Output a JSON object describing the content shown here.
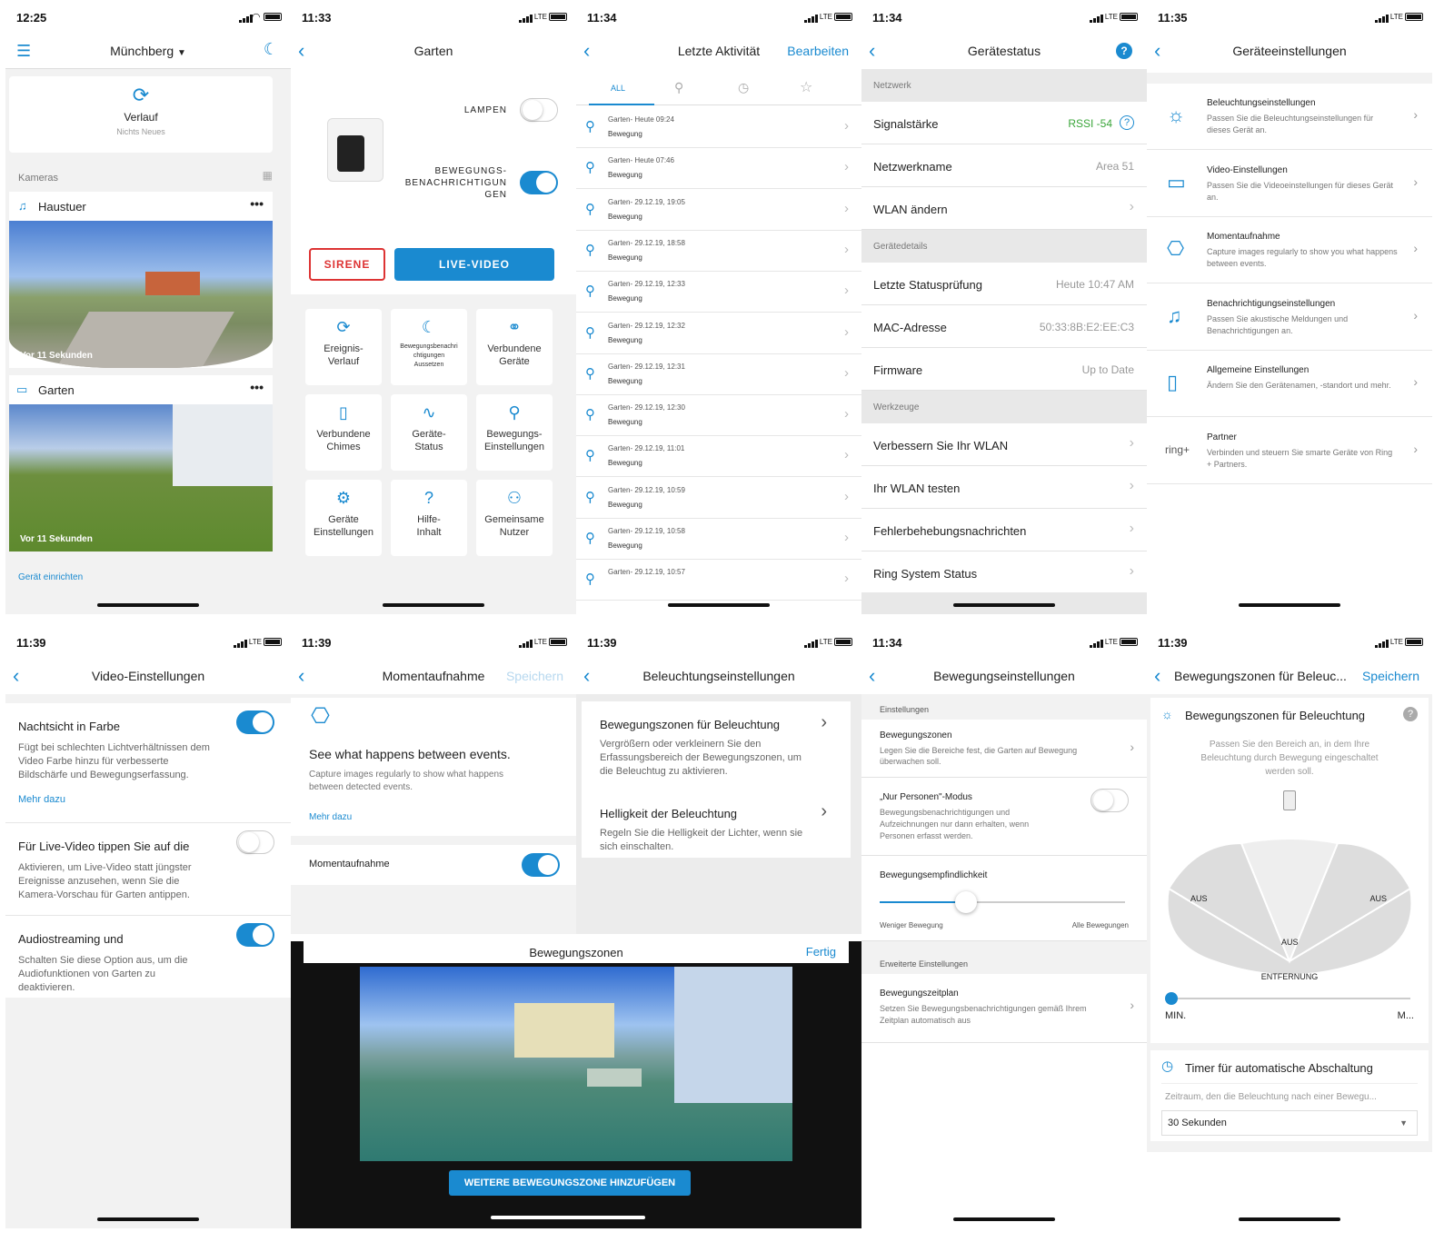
{
  "s1": {
    "time": "12:25",
    "location": "Münchberg",
    "history_title": "Verlauf",
    "history_sub": "Nichts Neues",
    "cameras_label": "Kameras",
    "cam1_name": "Haustuer",
    "cam1_time": "Vor 11 Sekunden",
    "cam2_name": "Garten",
    "cam2_time": "Vor 11 Sekunden",
    "setup_link": "Gerät einrichten"
  },
  "s2": {
    "time": "11:33",
    "title": "Garten",
    "lamps_label": "LAMPEN",
    "motion_label": "BEWEGUNGS-\nBENACHRICHTIGUN\nGEN",
    "siren": "SIRENE",
    "live": "LIVE-VIDEO",
    "tiles": [
      "Ereignis-\nVerlauf",
      "Bewegungsbenachri\nchtigungen\nAussetzen",
      "Verbundene\nGeräte",
      "Verbundene\nChimes",
      "Geräte-\nStatus",
      "Bewegungs-\nEinstellungen",
      "Geräte\nEinstellungen",
      "Hilfe-\nInhalt",
      "Gemeinsame\nNutzer"
    ]
  },
  "s3": {
    "time": "11:34",
    "title": "Letzte Aktivität",
    "edit": "Bearbeiten",
    "tab_all": "ALL",
    "events": [
      {
        "t": "Garten- Heute 09:24",
        "s": "Bewegung"
      },
      {
        "t": "Garten- Heute 07:46",
        "s": "Bewegung"
      },
      {
        "t": "Garten- 29.12.19, 19:05",
        "s": "Bewegung"
      },
      {
        "t": "Garten- 29.12.19, 18:58",
        "s": "Bewegung"
      },
      {
        "t": "Garten- 29.12.19, 12:33",
        "s": "Bewegung"
      },
      {
        "t": "Garten- 29.12.19, 12:32",
        "s": "Bewegung"
      },
      {
        "t": "Garten- 29.12.19, 12:31",
        "s": "Bewegung"
      },
      {
        "t": "Garten- 29.12.19, 12:30",
        "s": "Bewegung"
      },
      {
        "t": "Garten- 29.12.19, 11:01",
        "s": "Bewegung"
      },
      {
        "t": "Garten- 29.12.19, 10:59",
        "s": "Bewegung"
      },
      {
        "t": "Garten- 29.12.19, 10:58",
        "s": "Bewegung"
      },
      {
        "t": "Garten- 29.12.19, 10:57",
        "s": ""
      }
    ]
  },
  "s4": {
    "time": "11:34",
    "title": "Gerätestatus",
    "help": "?",
    "rows": [
      {
        "type": "h",
        "label": "Netzwerk"
      },
      {
        "type": "r",
        "label": "Signalstärke",
        "value": "RSSI -54",
        "green": true,
        "info": "?"
      },
      {
        "type": "r",
        "label": "Netzwerkname",
        "value": "Area 51"
      },
      {
        "type": "r",
        "label": "WLAN ändern",
        "chev": true
      },
      {
        "type": "h",
        "label": "Gerätedetails"
      },
      {
        "type": "r",
        "label": "Letzte Statusprüfung",
        "value": "Heute 10:47 AM"
      },
      {
        "type": "r",
        "label": "MAC-Adresse",
        "value": "50:33:8B:E2:EE:C3"
      },
      {
        "type": "r",
        "label": "Firmware",
        "value": "Up to Date"
      },
      {
        "type": "h",
        "label": "Werkzeuge"
      },
      {
        "type": "r",
        "label": "Verbessern Sie Ihr WLAN",
        "chev": true
      },
      {
        "type": "r",
        "label": "Ihr WLAN testen",
        "chev": true
      },
      {
        "type": "r",
        "label": "Fehlerbehebungsnachrichten",
        "chev": true
      },
      {
        "type": "r",
        "label": "Ring System Status",
        "chev": true
      }
    ]
  },
  "s5": {
    "time": "11:35",
    "title": "Geräteeinstellungen",
    "items": [
      {
        "icon": "bulb-icon",
        "t": "Beleuchtungseinstellungen",
        "s": "Passen Sie die Beleuchtungseinstellungen für dieses Gerät an."
      },
      {
        "icon": "video-icon",
        "t": "Video-Einstellungen",
        "s": "Passen Sie die Videoeinstellungen für dieses Gerät an."
      },
      {
        "icon": "camera-icon",
        "t": "Momentaufnahme",
        "s": "Capture images regularly to show you what happens between events."
      },
      {
        "icon": "bell-icon",
        "t": "Benachrichtigungseinstellungen",
        "s": "Passen Sie akustische Meldungen und Benachrichtigungen an."
      },
      {
        "icon": "device-icon",
        "t": "Allgemeine Einstellungen",
        "s": "Ändern Sie den Gerätenamen, -standort und mehr."
      },
      {
        "icon": "ring-icon",
        "t": "Partner",
        "s": "Verbinden und steuern Sie smarte Geräte von Ring + Partners."
      }
    ],
    "ring_logo": "ring+"
  },
  "s6": {
    "time": "11:39",
    "title": "Video-Einstellungen",
    "items": [
      {
        "t": "Nachtsicht in Farbe",
        "s": "Fügt bei schlechten Lichtverhältnissen dem Video Farbe hinzu für verbesserte Bildschärfe und Bewegungserfassung.",
        "link": "Mehr dazu",
        "on": true
      },
      {
        "t": "Für Live-Video tippen Sie auf die",
        "s": "Aktivieren, um Live-Video statt jüngster Ereignisse anzusehen, wenn Sie die Kamera-Vorschau für Garten antippen.",
        "on": false
      },
      {
        "t": "Audiostreaming und",
        "s": "Schalten Sie diese Option aus, um die Audiofunktionen von Garten zu deaktivieren.",
        "on": true
      }
    ]
  },
  "s7": {
    "time": "11:39",
    "title": "Momentaufnahme",
    "save": "Speichern",
    "headline": "See what happens between events.",
    "desc": "Capture images regularly to show what happens between detected events.",
    "link": "Mehr dazu",
    "toggle_label": "Momentaufnahme"
  },
  "s8": {
    "time": "11:39",
    "title": "Beleuchtungseinstellungen",
    "items": [
      {
        "t": "Bewegungszonen für Beleuchtung",
        "s": "Vergrößern oder verkleinern Sie den Erfassungsbereich der Bewegungszonen, um die Beleuchtug zu aktivieren."
      },
      {
        "t": "Helligkeit der Beleuchtung",
        "s": "Regeln Sie die Helligkeit der Lichter, wenn sie sich einschalten."
      }
    ]
  },
  "s9": {
    "title": "Bewegungszonen",
    "done": "Fertig",
    "add": "WEITERE BEWEGUNGSZONE HINZUFÜGEN"
  },
  "s10": {
    "time": "11:34",
    "title": "Bewegungseinstellungen",
    "sec1": "Einstellungen",
    "zones_t": "Bewegungszonen",
    "zones_s": "Legen Sie die Bereiche fest, die Garten auf Bewegung überwachen soll.",
    "persons_t": "„Nur Personen\"-Modus",
    "persons_s": "Bewegungsbenachrichtigungen und Aufzeichnungen nur dann erhalten, wenn Personen erfasst werden.",
    "sens_t": "Bewegungsempfindlichkeit",
    "sens_value": 0.35,
    "sens_min": "Weniger Bewegung",
    "sens_max": "Alle Bewegungen",
    "sec2": "Erweiterte Einstellungen",
    "sched_t": "Bewegungszeitplan",
    "sched_s": "Setzen Sie Bewegungsbenachrichtigungen gemäß Ihrem Zeitplan automatisch aus"
  },
  "s11": {
    "time": "11:39",
    "title": "Bewegungszonen für Beleuc...",
    "save": "Speichern",
    "card_t": "Bewegungszonen für Beleuchtung",
    "card_help": "?",
    "card_s": "Passen Sie den Bereich an, in dem Ihre Beleuchtung durch Bewegung eingeschaltet werden soll.",
    "zone1": "AUS",
    "zone2": "AUS",
    "zone3": "AUS",
    "distance": "ENTFERNUNG",
    "dist_value": 0.0,
    "min": "MIN.",
    "max": "M...",
    "timer_t": "Timer für automatische Abschaltung",
    "timer_s": "Zeitraum, den die Beleuchtung nach einer Bewegu...",
    "timer_value": "30 Sekunden"
  }
}
